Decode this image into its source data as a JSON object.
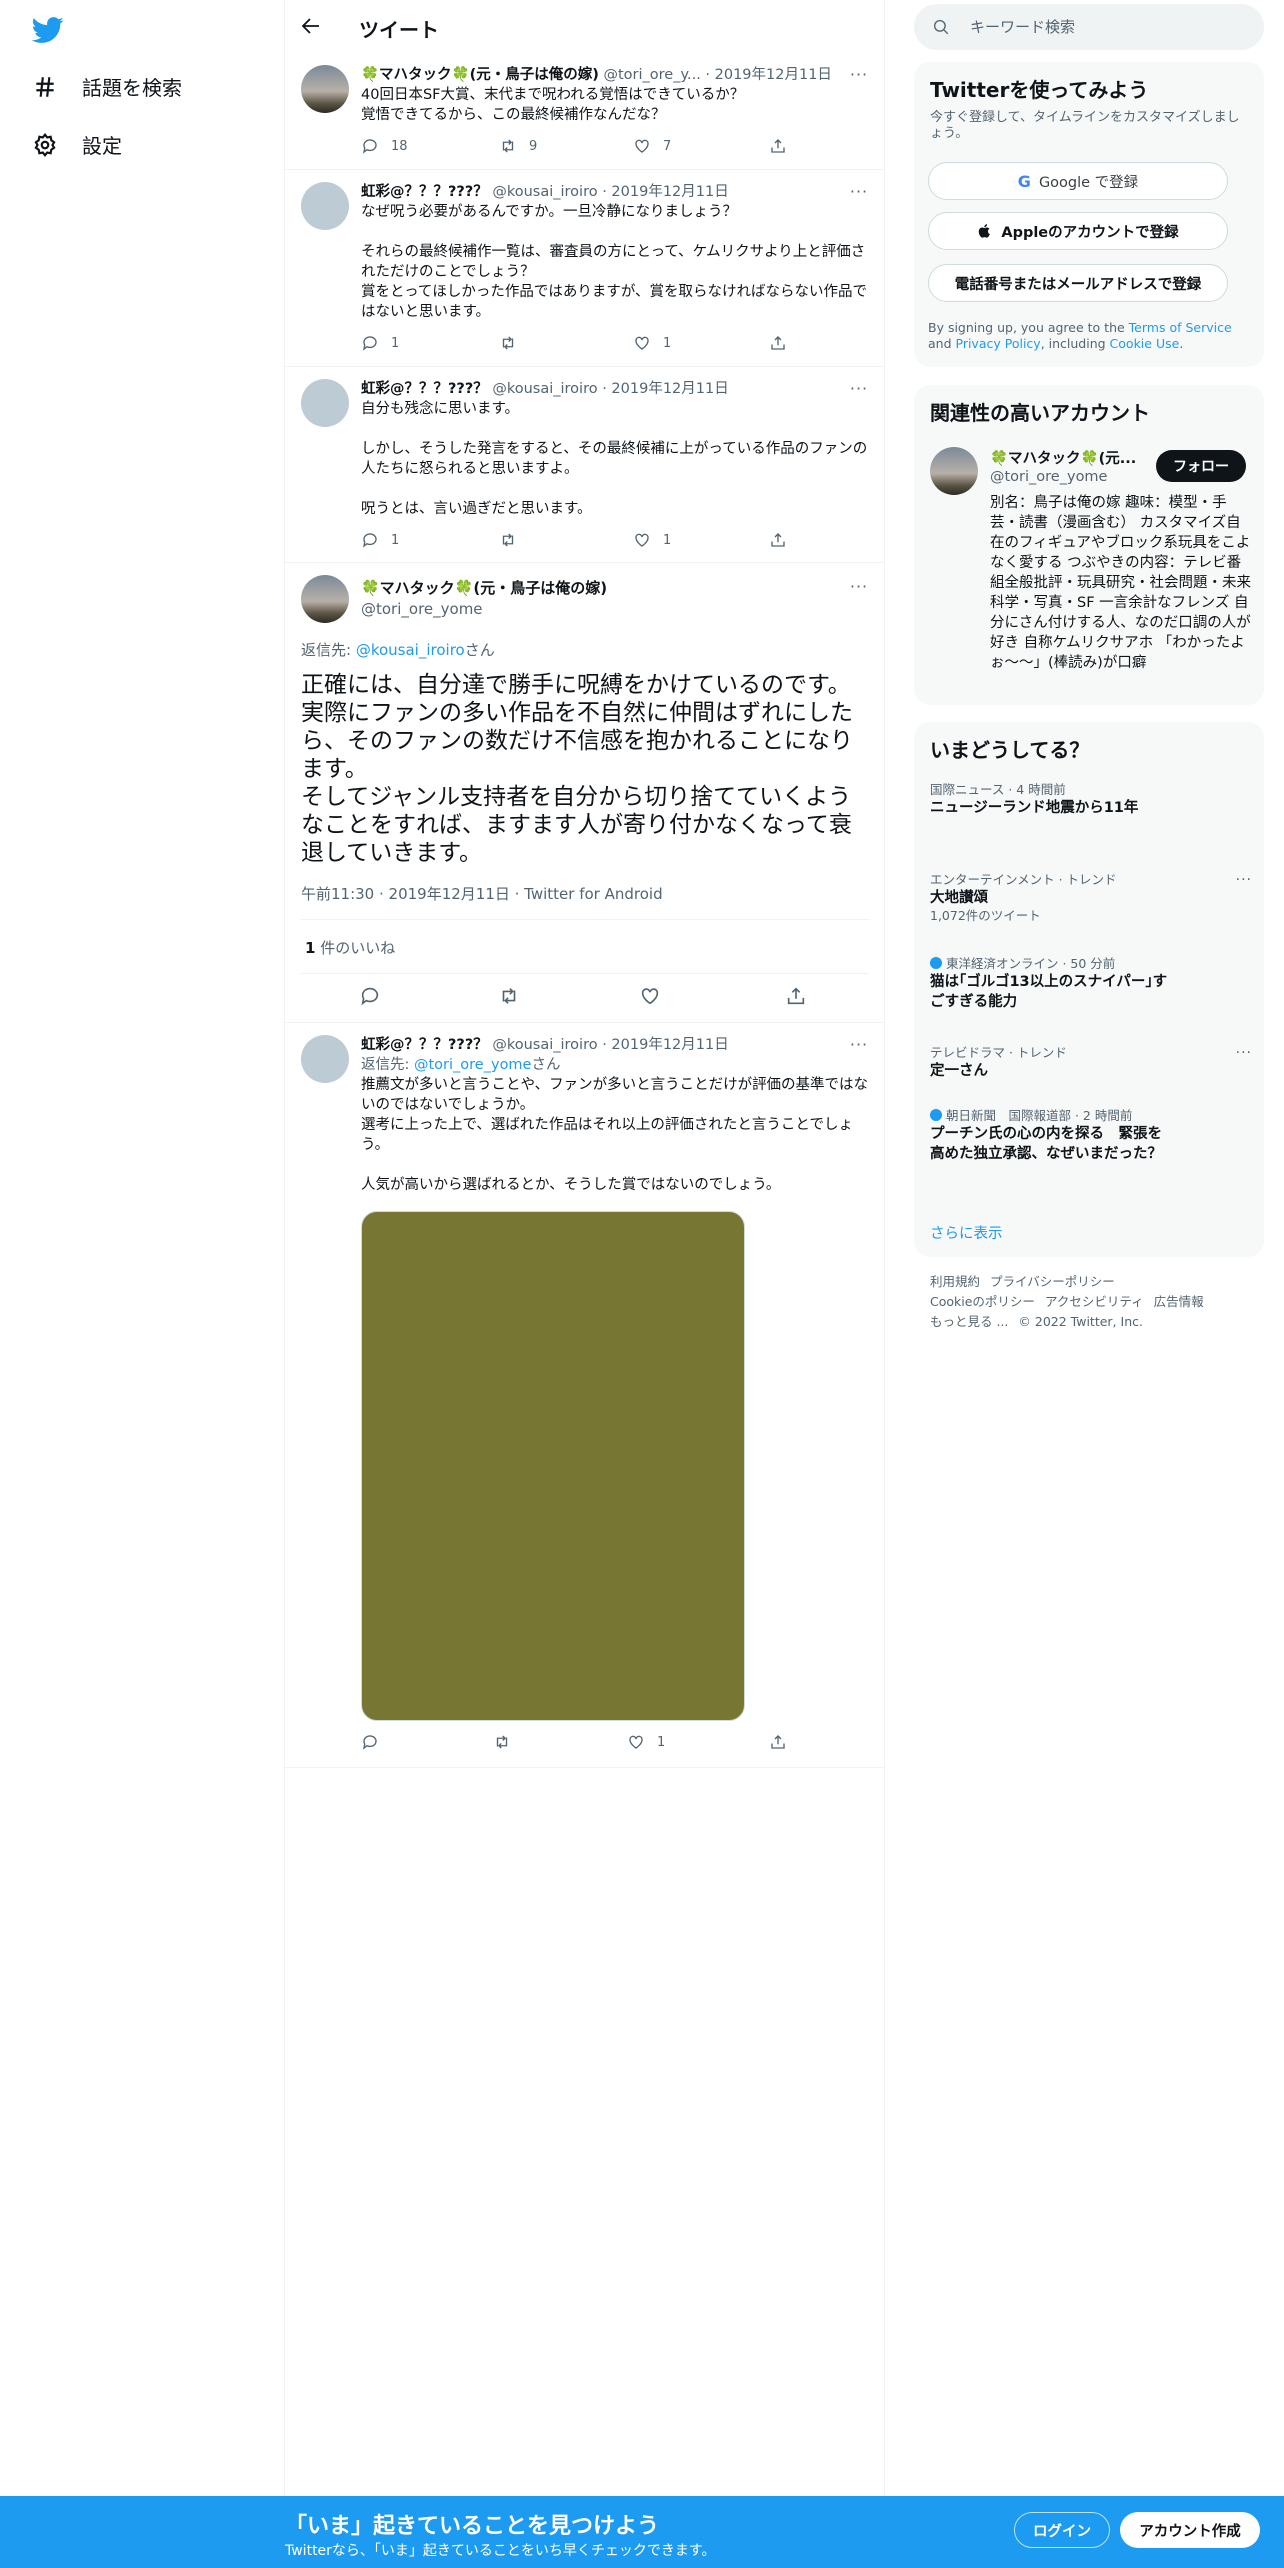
{
  "nav": {
    "explore": "話題を検索",
    "settings": "設定"
  },
  "header": {
    "title": "ツイート"
  },
  "tweets": [
    {
      "name": "🍀マハタック🍀(元・鳥子は俺の嫁)",
      "meta": "@tori_ore_y... · 2019年12月11日",
      "text": "40回日本SF大賞、末代まで呪われる覚悟はできているか？\n覚悟できてるから、この最終候補作なんだな？",
      "replies": "18",
      "retweets": "9",
      "likes": "7"
    },
    {
      "name": "虹彩@？？？???？",
      "meta": "@kousai_iroiro · 2019年12月11日",
      "text": "なぜ呪う必要があるんですか。一旦冷静になりましょう？\n\nそれらの最終候補作一覧は、審査員の方にとって、ケムリクサより上と評価されただけのことでしょう？\n賞をとってほしかった作品ではありますが、賞を取らなければならない作品ではないと思います。",
      "replies": "1",
      "retweets": "",
      "likes": "1"
    },
    {
      "name": "虹彩@？？？???？",
      "meta": "@kousai_iroiro · 2019年12月11日",
      "text": "自分も残念に思います。\n\nしかし、そうした発言をすると、その最終候補に上がっている作品のファンの人たちに怒られると思いますよ。\n\n呪うとは、言い過ぎだと思います。",
      "replies": "1",
      "retweets": "",
      "likes": "1"
    }
  ],
  "focused": {
    "name": "🍀マハタック🍀(元・鳥子は俺の嫁)",
    "handle": "@tori_ore_yome",
    "reply_prefix": "返信先: ",
    "reply_to": "@kousai_iroiro",
    "reply_suffix": "さん",
    "text": "正確には、自分達で勝手に呪縛をかけているのです。\n実際にファンの多い作品を不自然に仲間はずれにしたら、そのファンの数だけ不信感を抱かれることになります。\nそしてジャンル支持者を自分から切り捨てていくようなことをすれば、ますます人が寄り付かなくなって衰退していきます。",
    "meta": "午前11:30 · 2019年12月11日 · Twitter for Android",
    "likes_count": "1",
    "likes_label": " 件のいいね"
  },
  "reply": {
    "name": "虹彩@？？？???？",
    "meta": "@kousai_iroiro · 2019年12月11日",
    "reply_prefix": "返信先: ",
    "reply_to": "@tori_ore_yome",
    "reply_suffix": "さん",
    "text": "推薦文が多いと言うことや、ファンが多いと言うことだけが評価の基準ではないのではないでしょうか。\n選考に上った上で、選ばれた作品はそれ以上の評価されたと言うことでしょう。\n\n人気が高いから選ばれるとか、そうした賞ではないのでしょう。",
    "likes": "1"
  },
  "search": {
    "placeholder": "キーワード検索"
  },
  "signup_card": {
    "title": "Twitterを使ってみよう",
    "desc": "今すぐ登録して、タイムラインをカスタマイズしましょう。",
    "google": "Google で登録",
    "apple": "Appleのアカウントで登録",
    "phone": "電話番号またはメールアドレスで登録",
    "terms_1": "By signing up, you agree to the ",
    "terms_link1": "Terms of Service",
    "terms_2": " and ",
    "terms_link2": "Privacy Policy",
    "terms_3": ", including ",
    "terms_link3": "Cookie Use",
    "terms_4": "."
  },
  "related": {
    "title": "関連性の高いアカウント",
    "name": "🍀マハタック🍀(元...",
    "handle": "@tori_ore_yome",
    "follow": "フォロー",
    "bio": "別名：鳥子は俺の嫁 趣味：模型・手芸・読書（漫画含む） カスタマイズ自在のフィギュアやブロック系玩具をこよなく愛する つぶやきの内容：テレビ番組全般批評・玩具研究・社会問題・未来科学・写真・SF 一言余計なフレンズ 自分にさん付けする人、なのだ口調の人が好き 自称ケムリクサアホ 「わかったよぉ〜〜」(棒読み)が口癖"
  },
  "trends": {
    "title": "いまどうしてる？",
    "items": [
      {
        "cat": "国際ニュース · 4 時間前",
        "title": "ニュージーランド地震から11年",
        "count": ""
      },
      {
        "cat": "エンターテインメント · トレンド",
        "title": "大地讃頌",
        "count": "1,072件のツイート"
      },
      {
        "cat": "東洋経済オンライン · 50 分前",
        "title": "猫は｢ゴルゴ13以上のスナイパー｣すごすぎる能力",
        "count": ""
      },
      {
        "cat": "テレビドラマ · トレンド",
        "title": "定一さん",
        "count": ""
      },
      {
        "cat": "朝日新聞　国際報道部 · 2 時間前",
        "title": "プーチン氏の心の内を探る　緊張を高めた独立承認、なぜいまだった？",
        "count": ""
      }
    ],
    "more": "さらに表示"
  },
  "footer": {
    "terms": "利用規約",
    "privacy": "プライバシーポリシー",
    "cookie": "Cookieのポリシー",
    "access": "アクセシビリティ",
    "ads": "広告情報",
    "more": "もっと見る ...",
    "copy": "© 2022 Twitter, Inc."
  },
  "bottom": {
    "title": "「いま」起きていることを見つけよう",
    "sub": "Twitterなら、「いま」起きていることをいち早くチェックできます。",
    "login": "ログイン",
    "signup": "アカウント作成"
  },
  "colors": {
    "accent": "#1d9bf0",
    "media": "#787633",
    "text": "#0f1419",
    "muted": "#536471"
  }
}
